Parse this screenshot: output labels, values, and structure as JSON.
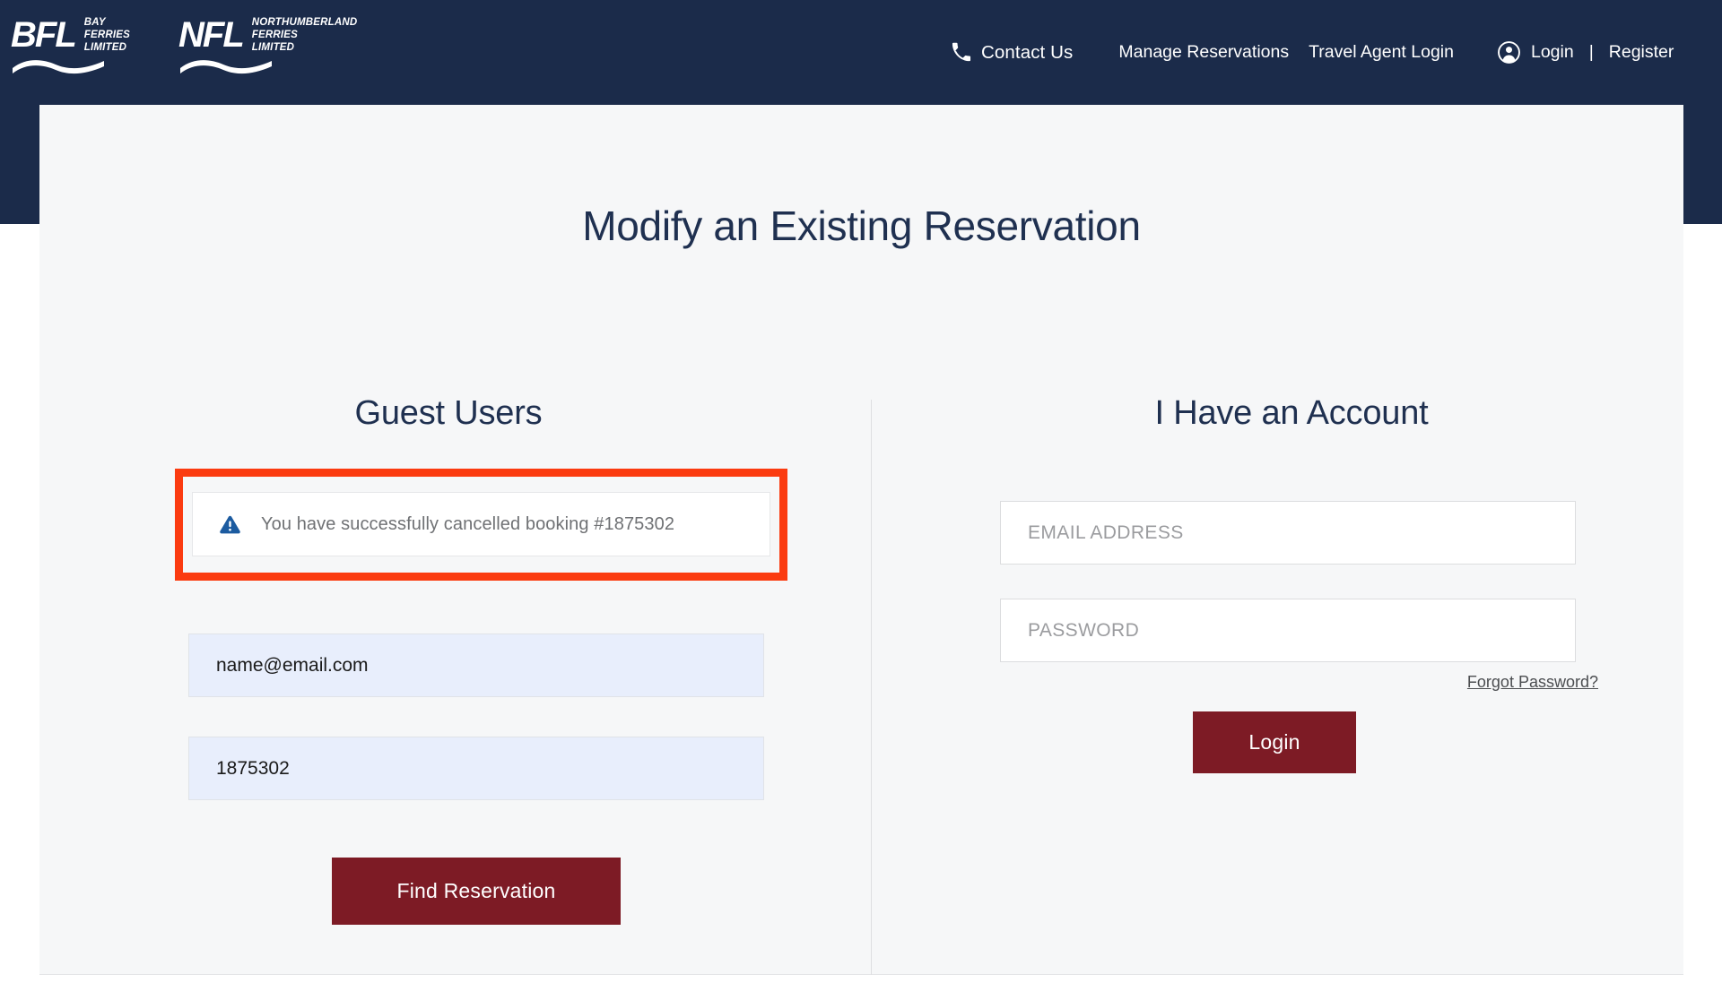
{
  "brand": {
    "logos": [
      {
        "mark": "BFL",
        "words": "Bay\nFerries\nLimited",
        "line1": "BAY",
        "line2": "FERRIES",
        "line3": "LIMITED"
      },
      {
        "mark": "NFL",
        "words": "Northumberland\nFerries\nLimited",
        "line1": "NORTHUMBERLAND",
        "line2": "FERRIES",
        "line3": "LIMITED"
      }
    ]
  },
  "header": {
    "contact_us": "Contact Us",
    "manage_reservations": "Manage Reservations",
    "travel_agent_login": "Travel Agent Login",
    "login": "Login",
    "separator": "|",
    "register": "Register",
    "phone_icon": "phone-icon",
    "account_icon": "user-circle-icon",
    "background_color": "#1b2b4a"
  },
  "main": {
    "page_title": "Modify an Existing Reservation",
    "background_color": "#f6f7f8"
  },
  "guest": {
    "title": "Guest Users",
    "alert": {
      "icon": "warning-triangle-icon",
      "message": "You have successfully cancelled booking #1875302",
      "icon_color": "#1c5ba0",
      "highlight_color": "#fb3b10"
    },
    "email_value": "name@email.com",
    "booking_value": "1875302",
    "find_button": "Find Reservation"
  },
  "account": {
    "title": "I Have an Account",
    "email_placeholder": "EMAIL ADDRESS",
    "password_placeholder": "PASSWORD",
    "forgot_password": "Forgot Password?",
    "login_button": "Login",
    "button_color": "#7d1b25"
  }
}
